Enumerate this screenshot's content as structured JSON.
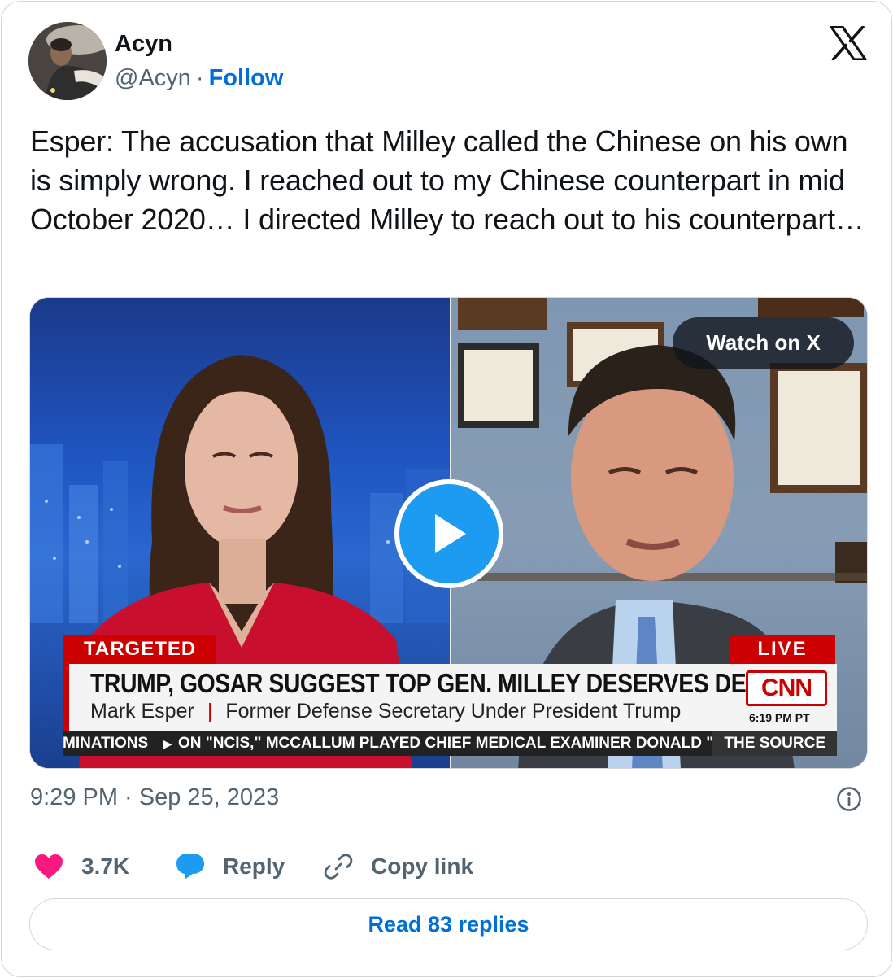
{
  "author": {
    "name": "Acyn",
    "handle": "@Acyn",
    "separator": "·",
    "follow_label": "Follow"
  },
  "tweet": {
    "text": "Esper: The accusation that Milley called the Chinese on his own is simply wrong. I reached out to my Chinese counterpart in mid October 2020… I directed Milley to reach out to his counterpart…"
  },
  "media": {
    "watch_label": "Watch on X",
    "chyron": {
      "tag": "TARGETED",
      "live": "LIVE",
      "headline": "TRUMP, GOSAR SUGGEST TOP GEN. MILLEY DESERVES DEATH",
      "name": "Mark Esper",
      "bar": "|",
      "title": "Former Defense Secretary Under President Trump",
      "network": "CNN",
      "time": "6:19 PM PT",
      "ticker_left": "MINATIONS",
      "ticker_main": "ON \"NCIS,\" MCCALLUM PLAYED CHIEF MEDICAL EXAMINER DONALD \"DUC",
      "ticker_right": "THE SOURCE"
    }
  },
  "footer": {
    "timestamp": "9:29 PM · Sep 25, 2023",
    "likes": "3.7K",
    "reply_label": "Reply",
    "copy_label": "Copy link",
    "read_replies": "Read 83 replies"
  },
  "colors": {
    "link": "#006fd6",
    "like": "#f91880",
    "reply": "#1d9bf0",
    "muted": "#536471",
    "cnn_red": "#cc0000"
  },
  "icons": [
    "x-logo-icon",
    "play-icon",
    "info-icon",
    "heart-icon",
    "reply-bubble-icon",
    "link-icon"
  ]
}
